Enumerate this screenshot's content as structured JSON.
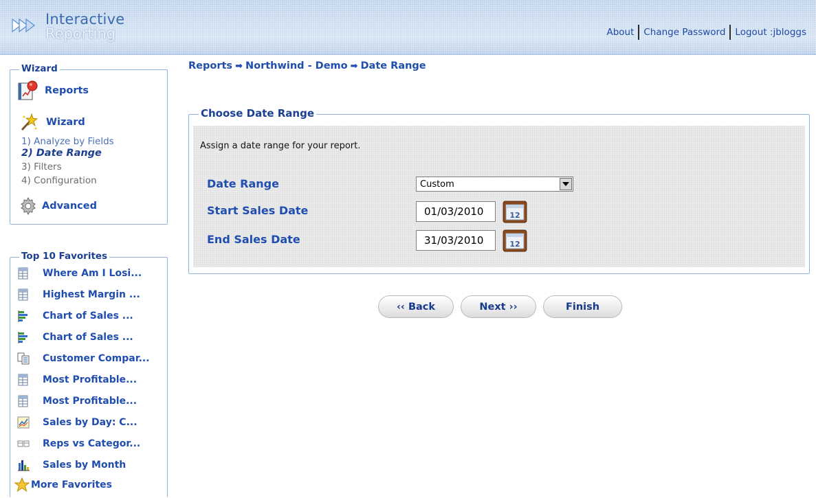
{
  "header": {
    "logo_line1": "Interactive",
    "logo_line2": "Reporting",
    "links": {
      "about": "About",
      "change_password": "Change Password",
      "logout": "Logout :jbloggs"
    }
  },
  "sidebar": {
    "wizard_legend": "Wizard",
    "reports_label": "Reports",
    "wizard_label": "Wizard",
    "steps": [
      "1) Analyze by Fields",
      "2) Date Range",
      "3) Filters",
      "4) Configuration"
    ],
    "current_step_index": 1,
    "advanced_label": "Advanced",
    "favorites_legend": "Top 10 Favorites",
    "favorites": [
      {
        "label": "Where Am I Losi...",
        "icon": "table-icon"
      },
      {
        "label": "Highest Margin ...",
        "icon": "table-icon"
      },
      {
        "label": "Chart of Sales ...",
        "icon": "bar-chart-icon"
      },
      {
        "label": "Chart of Sales ...",
        "icon": "bar-chart-icon"
      },
      {
        "label": "Customer Compar...",
        "icon": "compare-icon"
      },
      {
        "label": "Most Profitable...",
        "icon": "table-icon"
      },
      {
        "label": "Most Profitable...",
        "icon": "table-icon"
      },
      {
        "label": "Sales by Day: C...",
        "icon": "line-chart-icon"
      },
      {
        "label": "Reps vs Categor...",
        "icon": "crosstab-icon"
      },
      {
        "label": "Sales by Month",
        "icon": "column-chart-icon"
      }
    ],
    "more_favorites_label": "More Favorites"
  },
  "breadcrumb": {
    "items": [
      "Reports",
      "Northwind - Demo",
      "Date Range"
    ],
    "separator": "➡"
  },
  "date_range_panel": {
    "legend": "Choose Date Range",
    "instruction": "Assign a date range for your report.",
    "date_range_label": "Date Range",
    "date_range_value": "Custom",
    "start_label": "Start Sales Date",
    "start_value": "01/03/2010",
    "end_label": "End Sales Date",
    "end_value": "31/03/2010",
    "calendar_day": "12"
  },
  "buttons": {
    "back": "‹‹ Back",
    "next": "Next ››",
    "finish": "Finish"
  },
  "colors": {
    "accent": "#1f4db0",
    "border": "#8fb4e3",
    "header_bg": "#c5d9ef"
  }
}
